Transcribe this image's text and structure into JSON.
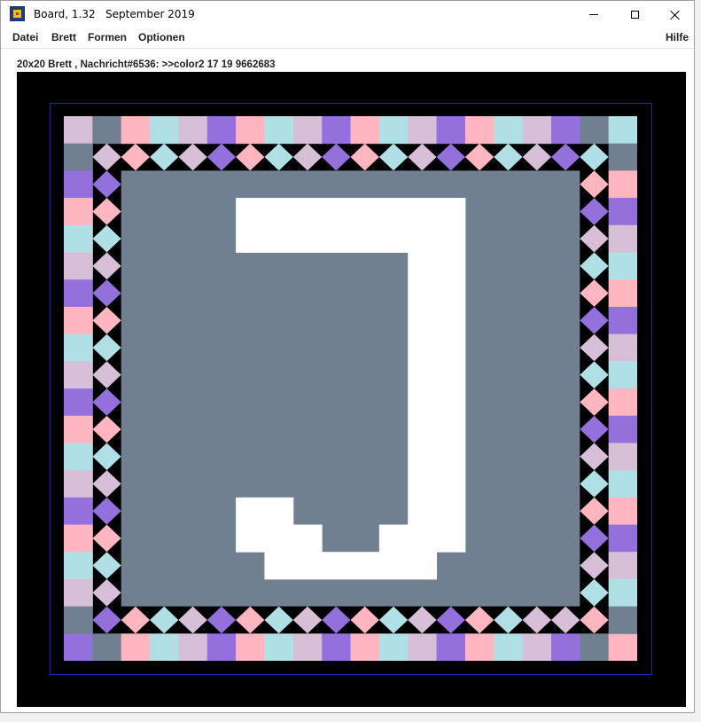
{
  "window": {
    "title": "Board, 1.32   September 2019",
    "icon": "board-app-icon",
    "controls": [
      "minimize-icon",
      "maximize-icon",
      "close-icon"
    ]
  },
  "menu": {
    "datei": "Datei",
    "brett": "Brett",
    "formen": "Formen",
    "optionen": "Optionen",
    "hilfe": "Hilfe"
  },
  "status": "20x20 Brett , Nachricht#6536: >>color2 17 19 9662683",
  "colors": {
    "background": "#000000",
    "slate": "#708090",
    "white": "#ffffff",
    "thistle": "#d8bfd8",
    "purple": "#9370db",
    "pink": "#ffb6c1",
    "powderblue": "#b0e0e6"
  },
  "board": {
    "size": 20,
    "outer_top": [
      "thistle",
      "slate",
      "pink",
      "powderblue",
      "thistle",
      "purple",
      "pink",
      "powderblue",
      "thistle",
      "purple",
      "pink",
      "powderblue",
      "thistle",
      "purple",
      "pink",
      "powderblue",
      "thistle",
      "purple",
      "slate",
      "powderblue"
    ],
    "outer_bottom": [
      "purple",
      "slate",
      "pink",
      "powderblue",
      "thistle",
      "purple",
      "pink",
      "powderblue",
      "thistle",
      "purple",
      "pink",
      "powderblue",
      "thistle",
      "purple",
      "pink",
      "powderblue",
      "thistle",
      "purple",
      "slate",
      "pink"
    ],
    "outer_left": [
      "slate",
      "purple",
      "pink",
      "powderblue",
      "thistle",
      "purple",
      "pink",
      "powderblue",
      "thistle",
      "purple",
      "pink",
      "powderblue",
      "thistle",
      "purple",
      "pink",
      "powderblue",
      "thistle",
      "slate"
    ],
    "outer_right": [
      "slate",
      "pink",
      "purple",
      "thistle",
      "powderblue",
      "pink",
      "purple",
      "thistle",
      "powderblue",
      "pink",
      "purple",
      "thistle",
      "powderblue",
      "pink",
      "purple",
      "thistle",
      "powderblue",
      "slate"
    ],
    "inner_top": [
      "thistle",
      "pink",
      "powderblue",
      "thistle",
      "purple",
      "pink",
      "powderblue",
      "thistle",
      "purple",
      "pink",
      "powderblue",
      "thistle",
      "purple",
      "pink",
      "powderblue",
      "thistle",
      "purple",
      "powderblue"
    ],
    "inner_bottom": [
      "purple",
      "pink",
      "powderblue",
      "thistle",
      "purple",
      "pink",
      "powderblue",
      "thistle",
      "purple",
      "pink",
      "powderblue",
      "thistle",
      "purple",
      "pink",
      "powderblue",
      "thistle",
      "thistle",
      "pink"
    ],
    "inner_left": [
      "purple",
      "pink",
      "powderblue",
      "thistle",
      "purple",
      "pink",
      "powderblue",
      "thistle",
      "purple",
      "pink",
      "powderblue",
      "thistle",
      "purple",
      "pink",
      "powderblue",
      "thistle"
    ],
    "inner_right": [
      "pink",
      "purple",
      "thistle",
      "powderblue",
      "pink",
      "purple",
      "thistle",
      "powderblue",
      "pink",
      "purple",
      "thistle",
      "powderblue",
      "pink",
      "purple",
      "thistle",
      "powderblue"
    ],
    "symbol": "J"
  }
}
